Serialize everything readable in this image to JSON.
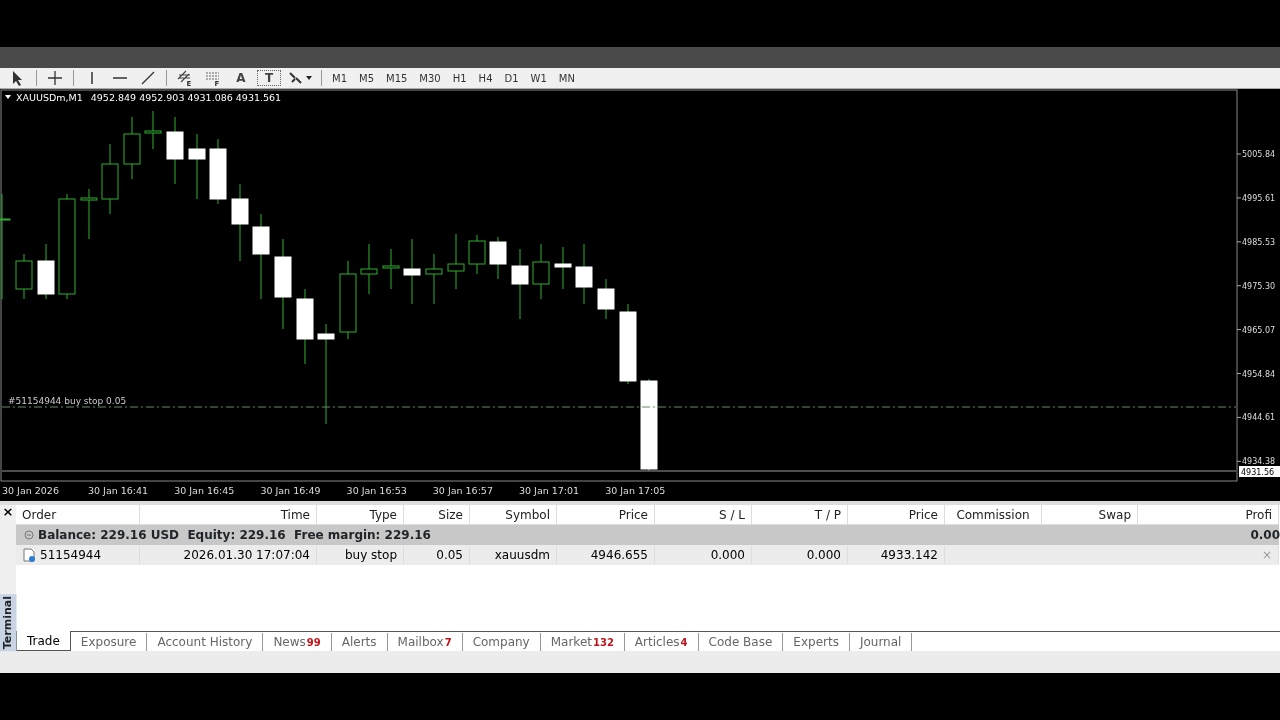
{
  "toolbar": {
    "tools": [
      {
        "kind": "cursor"
      },
      {
        "kind": "crosshair"
      },
      {
        "kind": "vline"
      },
      {
        "kind": "hline"
      },
      {
        "kind": "trendline"
      },
      {
        "kind": "channel",
        "glyph": "E"
      },
      {
        "kind": "fibo",
        "glyph": "F"
      },
      {
        "kind": "text",
        "glyph": "A"
      },
      {
        "kind": "label",
        "glyph": "T"
      },
      {
        "kind": "arrows"
      }
    ],
    "timeframes": [
      "M1",
      "M5",
      "M15",
      "M30",
      "H1",
      "H4",
      "D1",
      "W1",
      "MN"
    ]
  },
  "chart": {
    "title": "XAUUSDm,M1",
    "ohlc": "4952.849 4952.903 4931.086 4931.561",
    "order_line_label": "#51154944 buy stop 0.05",
    "price_labels": [
      "5005.84",
      "4995.61",
      "4985.53",
      "4975.30",
      "4965.07",
      "4954.84",
      "4944.61",
      "4934.38"
    ],
    "bid_label": "4931.56",
    "time_labels": [
      "30 Jan 2026",
      "30 Jan 16:41",
      "30 Jan 16:45",
      "30 Jan 16:49",
      "30 Jan 16:53",
      "30 Jan 16:57",
      "30 Jan 17:01",
      "30 Jan 17:05"
    ]
  },
  "terminal": {
    "side_label": "Terminal",
    "close": "×",
    "columns": [
      "Order",
      "Time",
      "Type",
      "Size",
      "Symbol",
      "Price",
      "S / L",
      "T / P",
      "Price",
      "Commission",
      "Swap",
      "Profi"
    ],
    "balance_row": {
      "summary": "Balance: 229.16 USD  Equity: 229.16  Free margin: 229.16",
      "profit": "0.00"
    },
    "rows": [
      {
        "cells": [
          "51154944",
          "2026.01.30 17:07:04",
          "buy stop",
          "0.05",
          "xauusdm",
          "4946.655",
          "0.000",
          "0.000",
          "4933.142",
          "",
          "",
          ""
        ],
        "close": "×"
      }
    ],
    "tabs": [
      {
        "label": "Trade",
        "selected": true
      },
      {
        "label": "Exposure",
        "selected": false
      },
      {
        "label": "Account History",
        "selected": false
      },
      {
        "label": "News",
        "count": "99",
        "selected": false
      },
      {
        "label": "Alerts",
        "selected": false
      },
      {
        "label": "Mailbox",
        "count": "7",
        "selected": false
      },
      {
        "label": "Company",
        "selected": false
      },
      {
        "label": "Market",
        "count": "132",
        "selected": false
      },
      {
        "label": "Articles",
        "count": "4",
        "selected": false
      },
      {
        "label": "Code Base",
        "selected": false
      },
      {
        "label": "Experts",
        "selected": false
      },
      {
        "label": "Journal",
        "selected": false
      }
    ]
  }
}
